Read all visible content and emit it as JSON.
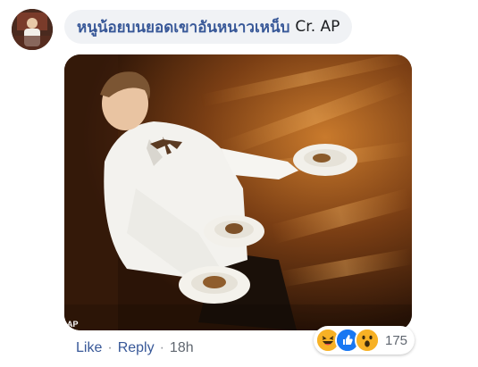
{
  "comment": {
    "author": "หนูน้อยบนยอดเขาอันหนาวเหน็บ",
    "text": "Cr. AP",
    "photo_credit": "AP",
    "actions": {
      "like_label": "Like",
      "separator": "·",
      "reply_label": "Reply",
      "timestamp": "18h"
    },
    "reactions": {
      "icons": [
        "haha-icon",
        "like-icon",
        "wow-icon"
      ],
      "count": "175"
    }
  },
  "colors": {
    "name_blue": "#385898",
    "bubble_bg": "#f0f2f5",
    "like_blue": "#1877f2",
    "reaction_yellow": "#f7b125"
  }
}
